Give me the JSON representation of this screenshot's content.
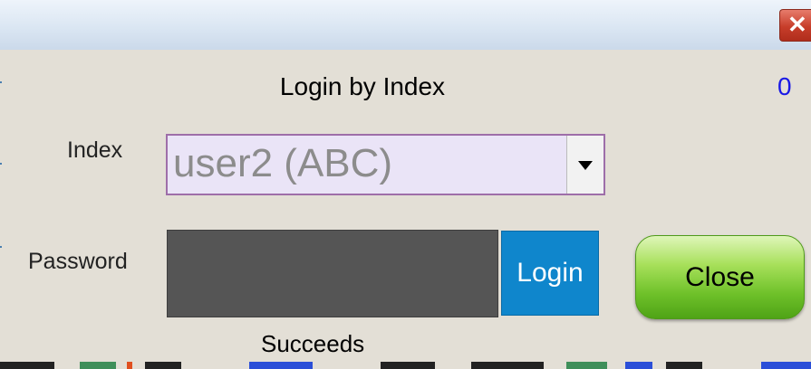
{
  "dialog": {
    "close_icon_glyph": "✕",
    "title": "Login by Index",
    "counter": "0",
    "index_label": "Index",
    "index_selected": "user2 (ABC)",
    "password_label": "Password",
    "password_value": "",
    "login_label": "Login",
    "close_label": "Close",
    "status": "Succeeds"
  },
  "colors": {
    "counter": "#1919e6",
    "login_button": "#0f86cc",
    "close_button": "#6fc12a",
    "password_field": "#555555",
    "select_border": "#9e6ea9",
    "select_bg": "#eae4f7"
  }
}
